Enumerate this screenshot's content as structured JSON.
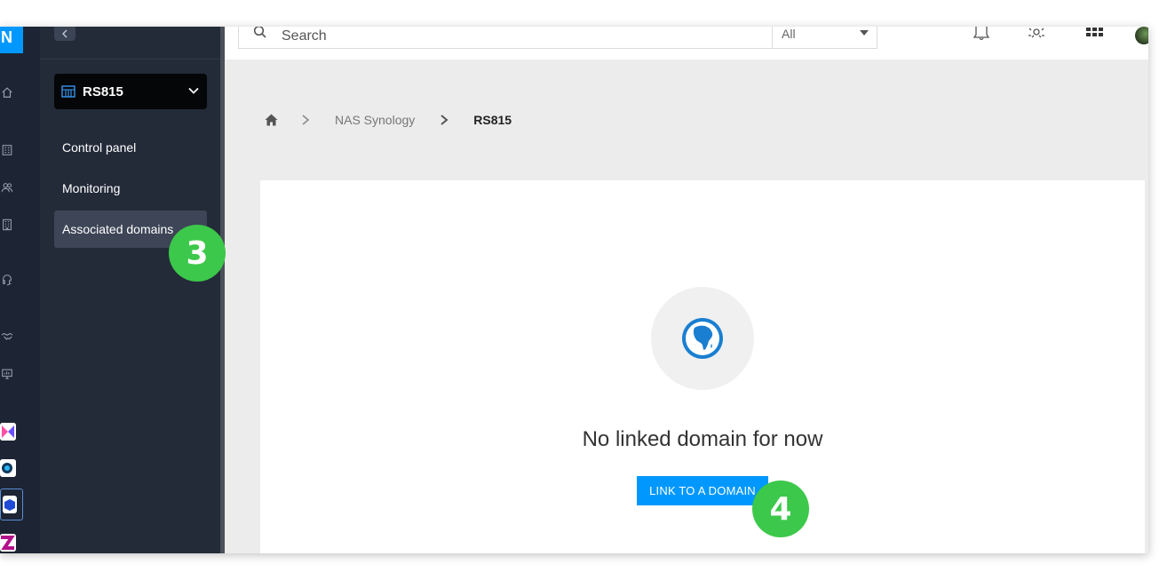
{
  "brand": {
    "letter": "N"
  },
  "search": {
    "placeholder": "Search",
    "scope": "All"
  },
  "sidebar": {
    "device": "RS815",
    "items": [
      {
        "label": "Control panel"
      },
      {
        "label": "Monitoring"
      },
      {
        "label": "Associated domains"
      }
    ]
  },
  "breadcrumb": {
    "items": [
      "NAS Synology",
      "RS815"
    ]
  },
  "main": {
    "empty_message": "No linked domain for now",
    "link_button": "LINK TO A DOMAIN"
  },
  "annotations": {
    "step_3": "3",
    "step_4": "4"
  },
  "colors": {
    "accent": "#0098ff",
    "rail_bg": "#1d2433",
    "sidebar_bg": "#232b39",
    "badge_green": "#3cc84a"
  },
  "icons": [
    "home-icon",
    "users-icon",
    "building-icon",
    "support-icon",
    "handshake-icon",
    "monitor-icon",
    "bell-icon",
    "settings-icon",
    "apps-grid-icon",
    "search-icon",
    "globe-africa-icon"
  ]
}
